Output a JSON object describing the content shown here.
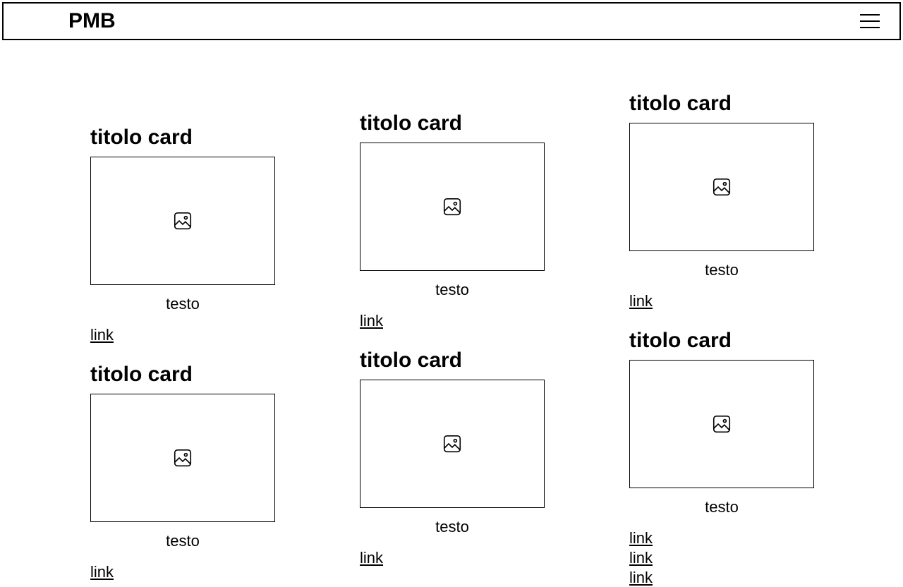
{
  "header": {
    "logo": "PMB"
  },
  "columns": [
    {
      "cards": [
        {
          "title": "titolo card",
          "text": "testo",
          "links": [
            "link"
          ]
        },
        {
          "title": "titolo card",
          "text": "testo",
          "links": [
            "link"
          ]
        }
      ]
    },
    {
      "cards": [
        {
          "title": "titolo card",
          "text": "testo",
          "links": [
            "link"
          ]
        },
        {
          "title": "titolo card",
          "text": "testo",
          "links": [
            "link"
          ]
        }
      ]
    },
    {
      "cards": [
        {
          "title": "titolo card",
          "text": "testo",
          "links": [
            "link"
          ]
        },
        {
          "title": "titolo card",
          "text": "testo",
          "links": [
            "link",
            "link",
            "link"
          ]
        }
      ]
    }
  ]
}
